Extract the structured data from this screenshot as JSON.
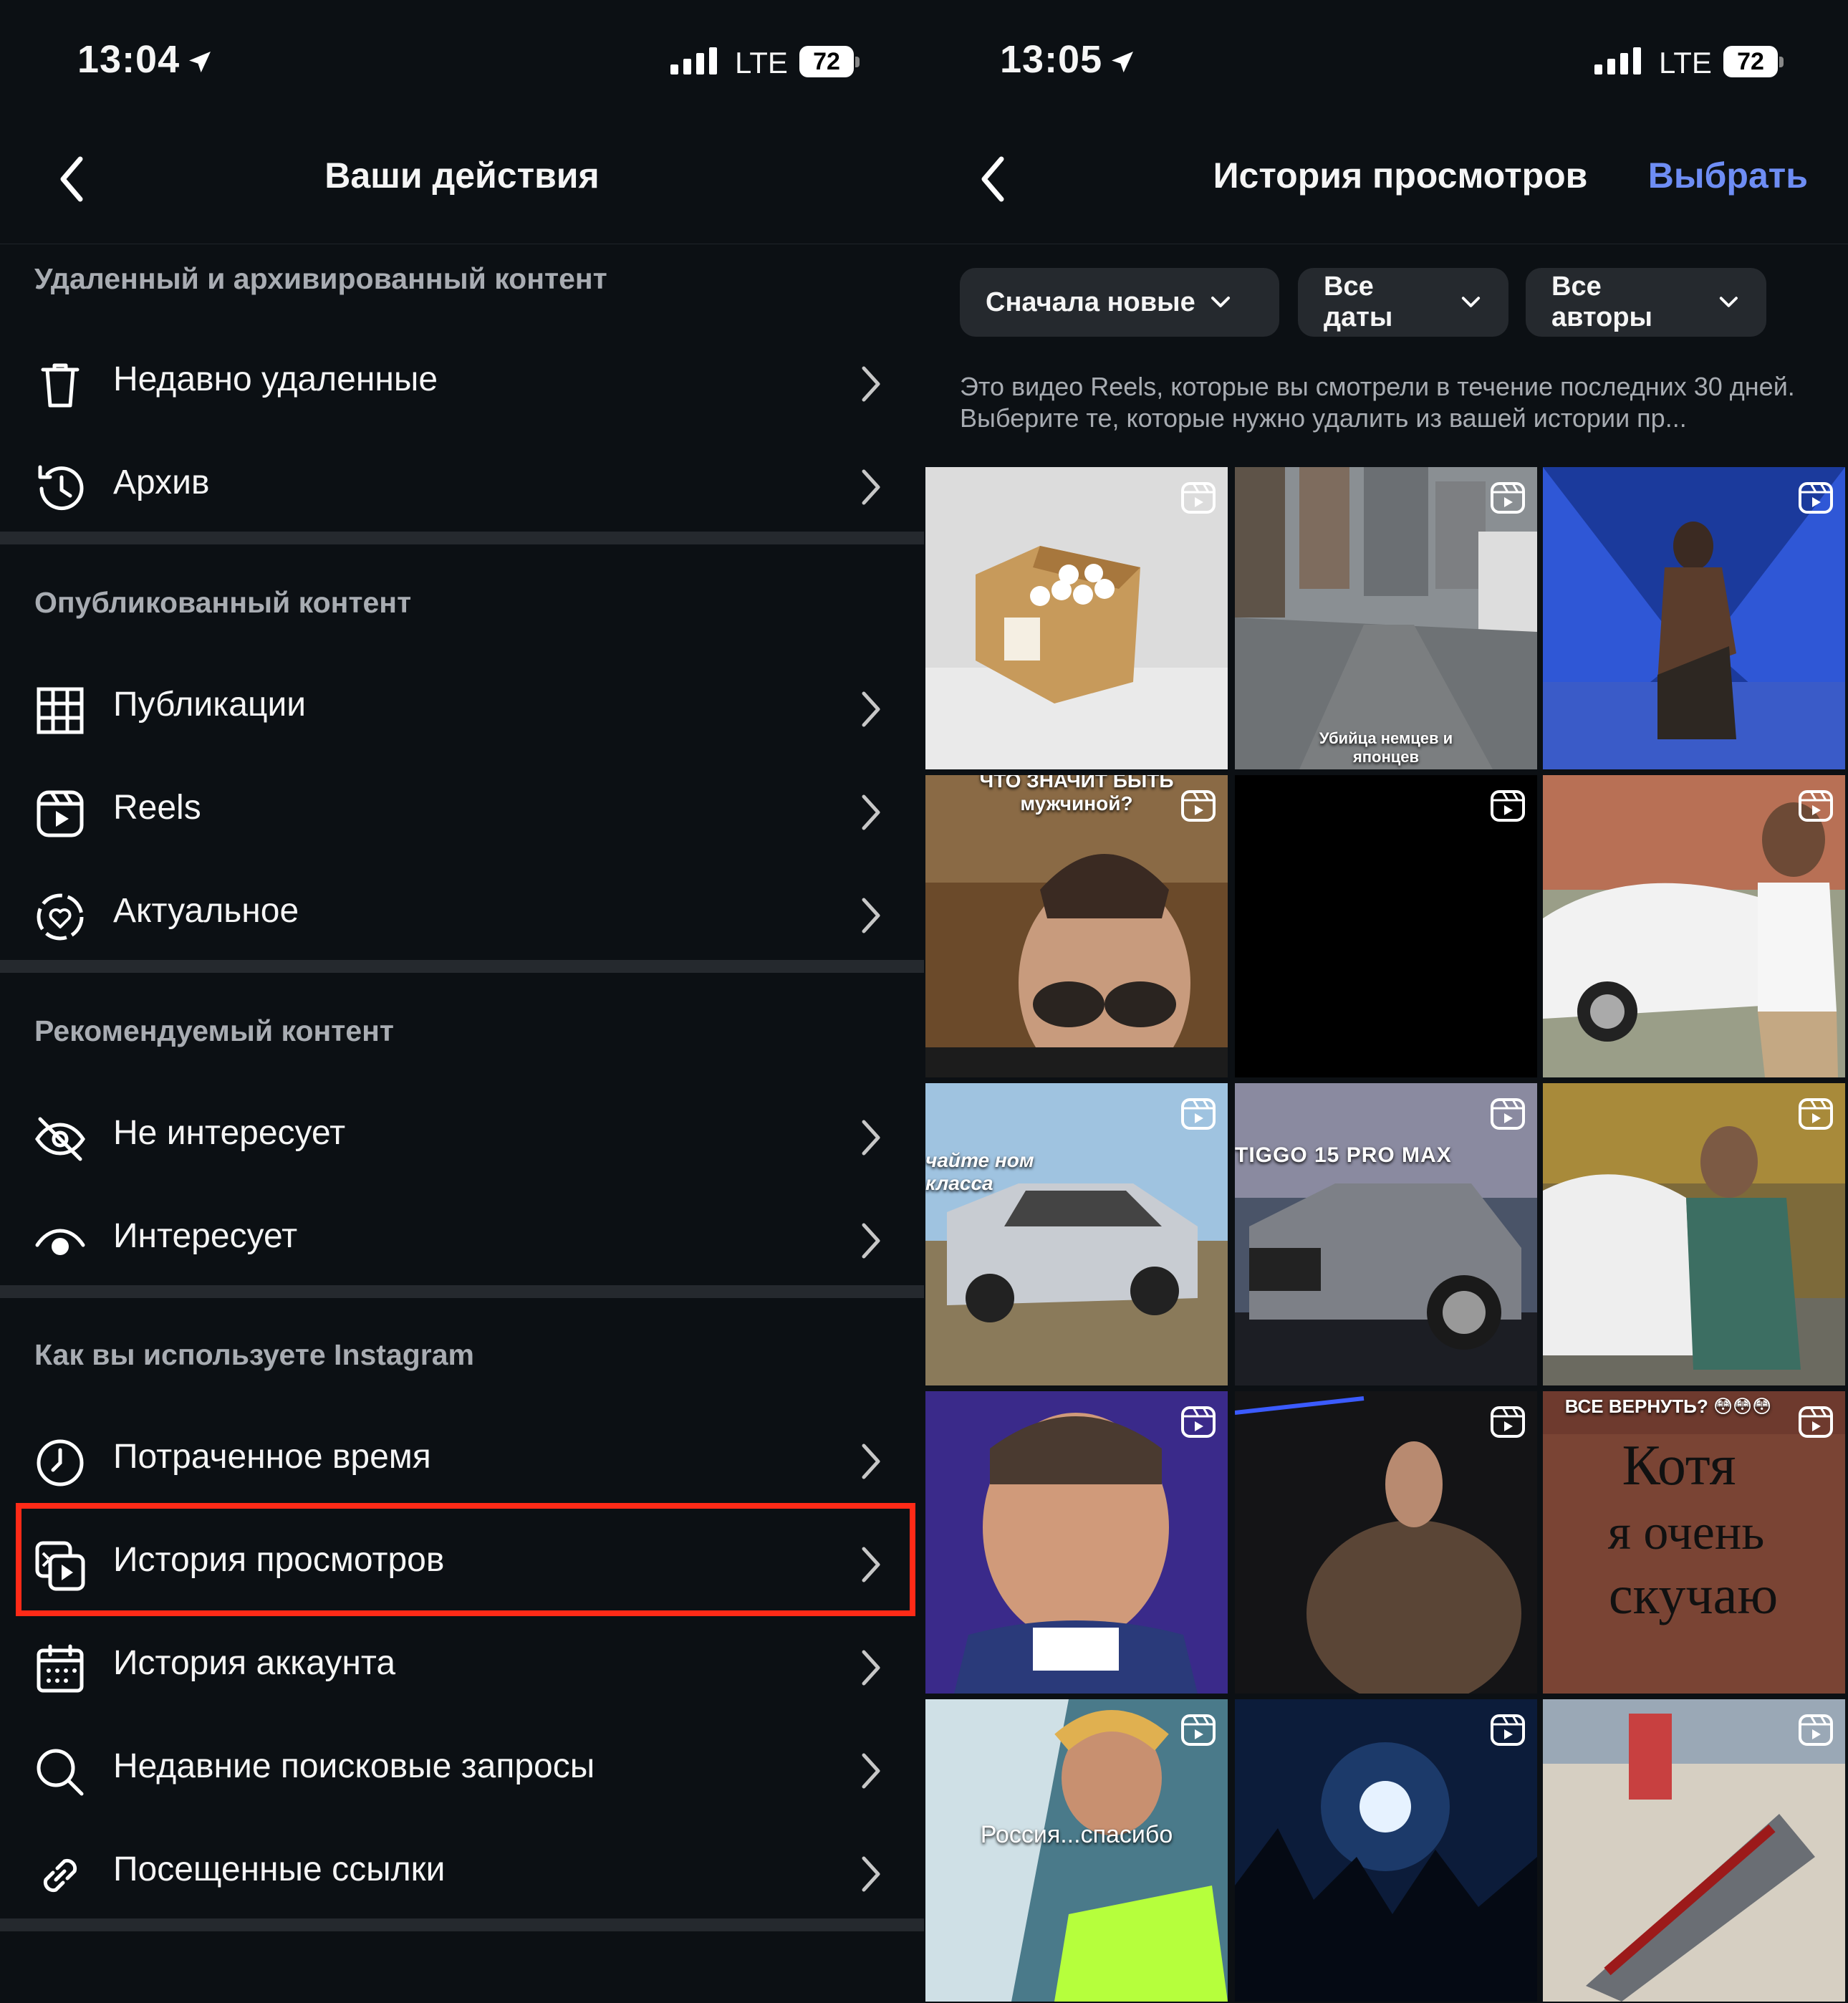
{
  "left": {
    "status": {
      "time": "13:04",
      "network": "LTE",
      "battery": "72"
    },
    "title": "Ваши действия",
    "sections": [
      {
        "header": "Удаленный и архивированный контент",
        "items": [
          {
            "label": "Недавно удаленные",
            "icon": "trash-icon"
          },
          {
            "label": "Архив",
            "icon": "archive-icon"
          }
        ]
      },
      {
        "header": "Опубликованный контент",
        "items": [
          {
            "label": "Публикации",
            "icon": "grid-icon"
          },
          {
            "label": "Reels",
            "icon": "reels-icon"
          },
          {
            "label": "Актуальное",
            "icon": "highlights-icon"
          }
        ]
      },
      {
        "header": "Рекомендуемый контент",
        "items": [
          {
            "label": "Не интересует",
            "icon": "eye-off-icon"
          },
          {
            "label": "Интересует",
            "icon": "eye-icon"
          }
        ]
      },
      {
        "header": "Как вы используете Instagram",
        "items": [
          {
            "label": "Потраченное время",
            "icon": "clock-icon"
          },
          {
            "label": "История просмотров",
            "icon": "watch-history-icon",
            "highlighted": true
          },
          {
            "label": "История аккаунта",
            "icon": "calendar-icon"
          },
          {
            "label": "Недавние поисковые запросы",
            "icon": "search-icon"
          },
          {
            "label": "Посещенные ссылки",
            "icon": "link-icon"
          }
        ]
      }
    ],
    "highlight_color": "#ff2a17"
  },
  "right": {
    "status": {
      "time": "13:05",
      "network": "LTE",
      "battery": "72"
    },
    "title": "История просмотров",
    "select_label": "Выбрать",
    "accent": "#6e8df4",
    "filters": [
      "Сначала новые",
      "Все даты",
      "Все авторы"
    ],
    "description": "Это видео Reels, которые вы смотрели в течение последних 30 дней. Выберите те, которые нужно удалить из вашей истории пр...",
    "thumbnails": [
      {
        "caption": ""
      },
      {
        "caption": "Убийца немцев и японцев"
      },
      {
        "caption": ""
      },
      {
        "caption": "ЧТО ЗНАЧИТ БЫТЬ мужчиной?"
      },
      {
        "caption": ""
      },
      {
        "caption": ""
      },
      {
        "caption": "чайте ном класса"
      },
      {
        "caption": "TIGGO 15 PRO MAX"
      },
      {
        "caption": ""
      },
      {
        "caption": ""
      },
      {
        "caption": ""
      },
      {
        "caption": "ВСЕ ВЕРНУТЬ? 😳😳😳"
      },
      {
        "caption": "Россия...спасибо"
      },
      {
        "caption": ""
      },
      {
        "caption": ""
      }
    ]
  }
}
